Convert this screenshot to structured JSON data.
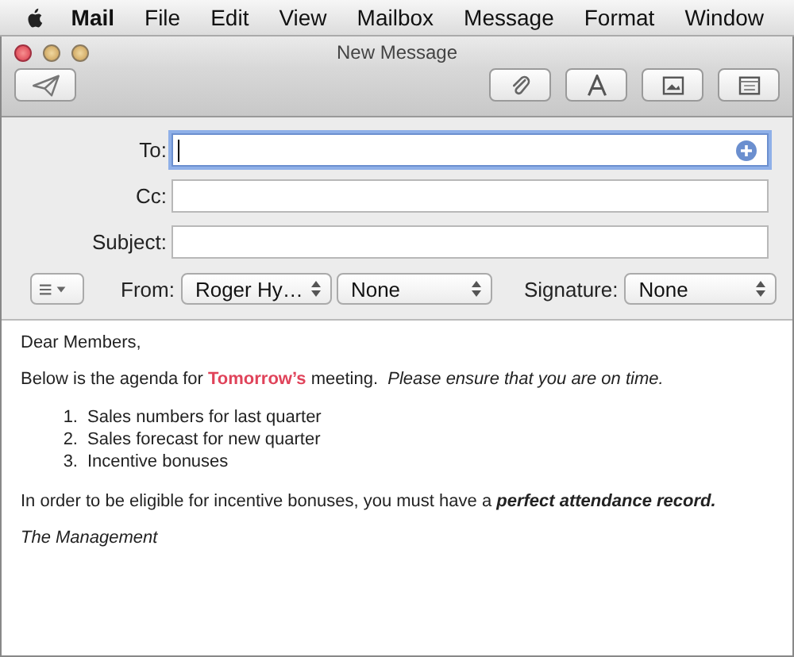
{
  "menu_bar": [
    {
      "label": "Mail",
      "kind": "app"
    },
    {
      "label": "File",
      "kind": "menu"
    },
    {
      "label": "Edit",
      "kind": "menu"
    },
    {
      "label": "View",
      "kind": "menu"
    },
    {
      "label": "Mailbox",
      "kind": "menu"
    },
    {
      "label": "Message",
      "kind": "menu"
    },
    {
      "label": "Format",
      "kind": "menu"
    },
    {
      "label": "Window",
      "kind": "menu"
    }
  ],
  "window": {
    "title": "New Message"
  },
  "toolbar": {
    "left": [
      {
        "kind": "send"
      }
    ],
    "right": [
      {
        "kind": "attach"
      },
      {
        "kind": "fonts"
      },
      {
        "kind": "photo"
      },
      {
        "kind": "template"
      }
    ]
  },
  "fields": [
    {
      "label": "To:",
      "focused": true,
      "add_button": true
    },
    {
      "label": "Cc:",
      "focused": false,
      "add_button": false
    },
    {
      "label": "Subject:",
      "focused": false,
      "add_button": false
    }
  ],
  "from_row": {
    "from_label": "From:",
    "from_value": "Roger Hy…",
    "account_value": "None",
    "signature_label": "Signature:",
    "signature_value": "None"
  },
  "body": [
    {
      "kind": "para",
      "runs": [
        {
          "kind": "text",
          "text": "Dear Members,"
        }
      ]
    },
    {
      "kind": "para",
      "runs": [
        {
          "kind": "text",
          "text": "Below is the agenda for "
        },
        {
          "kind": "text",
          "text": "**Tomorrow’s**",
          "color": "#e0435a"
        },
        {
          "kind": "text",
          "text": " meeting.  *Please ensure that you are on time.*"
        }
      ]
    },
    {
      "kind": "list",
      "items": [
        {
          "number": "1.",
          "text": "Sales numbers for last quarter"
        },
        {
          "number": "2.",
          "text": "Sales forecast for new quarter"
        },
        {
          "number": "3.",
          "text": "Incentive bonuses"
        }
      ]
    },
    {
      "kind": "para",
      "runs": [
        {
          "kind": "text",
          "text": "In order to be eligible for incentive bonuses, you must have a "
        },
        {
          "kind": "emphasis",
          "text": "perfect attendance record."
        }
      ]
    },
    {
      "kind": "para",
      "runs": [
        {
          "kind": "text",
          "text": "*The Management*"
        }
      ]
    }
  ]
}
